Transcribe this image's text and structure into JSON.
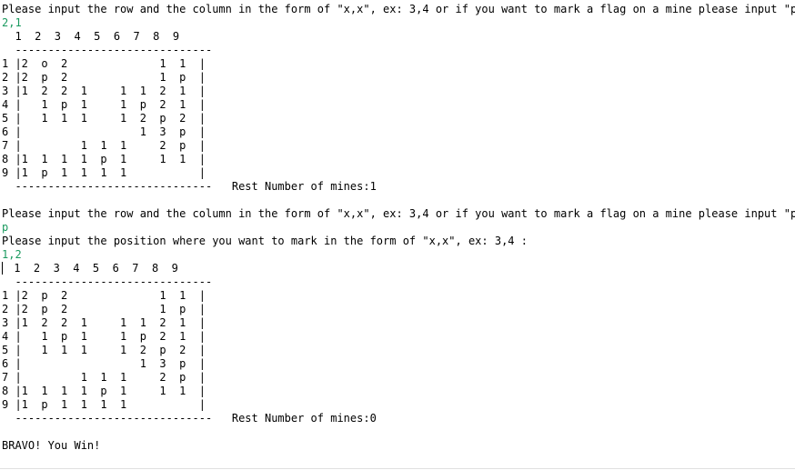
{
  "console": {
    "session1": {
      "prompt": "Please input the row and the column in the form of \"x,x\", ex: 3,4 or if you want to mark a flag on a mine please input \"p\":",
      "input": "2,1",
      "header": "  1  2  3  4  5  6  7  8  9",
      "top_rule": "  ------------------------------",
      "rows": [
        "1 |2  o  2              1  1  |",
        "2 |2  p  2              1  p  |",
        "3 |1  2  2  1     1  1  2  1  |",
        "4 |   1  p  1     1  p  2  1  |",
        "5 |   1  1  1     1  2  p  2  |",
        "6 |                  1  3  p  |",
        "7 |         1  1  1     2  p  |",
        "8 |1  1  1  1  p  1     1  1  |",
        "9 |1  p  1  1  1  1           |"
      ],
      "bottom_rule": "  ------------------------------   Rest Number of mines:1"
    },
    "session2": {
      "prompt": "Please input the row and the column in the form of \"x,x\", ex: 3,4 or if you want to mark a flag on a mine please input \"p\":",
      "input_mode": "p",
      "mark_prompt": "Please input the position where you want to mark in the form of \"x,x\", ex: 3,4 :",
      "input": "1,2",
      "header": " 1  2  3  4  5  6  7  8  9",
      "top_rule": "  ------------------------------",
      "rows": [
        "1 |2  p  2              1  1  |",
        "2 |2  p  2              1  p  |",
        "3 |1  2  2  1     1  1  2  1  |",
        "4 |   1  p  1     1  p  2  1  |",
        "5 |   1  1  1     1  2  p  2  |",
        "6 |                  1  3  p  |",
        "7 |         1  1  1     2  p  |",
        "8 |1  1  1  1  p  1     1  1  |",
        "9 |1  p  1  1  1  1           |"
      ],
      "bottom_rule": "  ------------------------------   Rest Number of mines:0"
    },
    "result": "BRAVO! You Win!"
  },
  "colors": {
    "text": "#000000",
    "input_echo": "#1a9a5f",
    "background": "#ffffff"
  }
}
